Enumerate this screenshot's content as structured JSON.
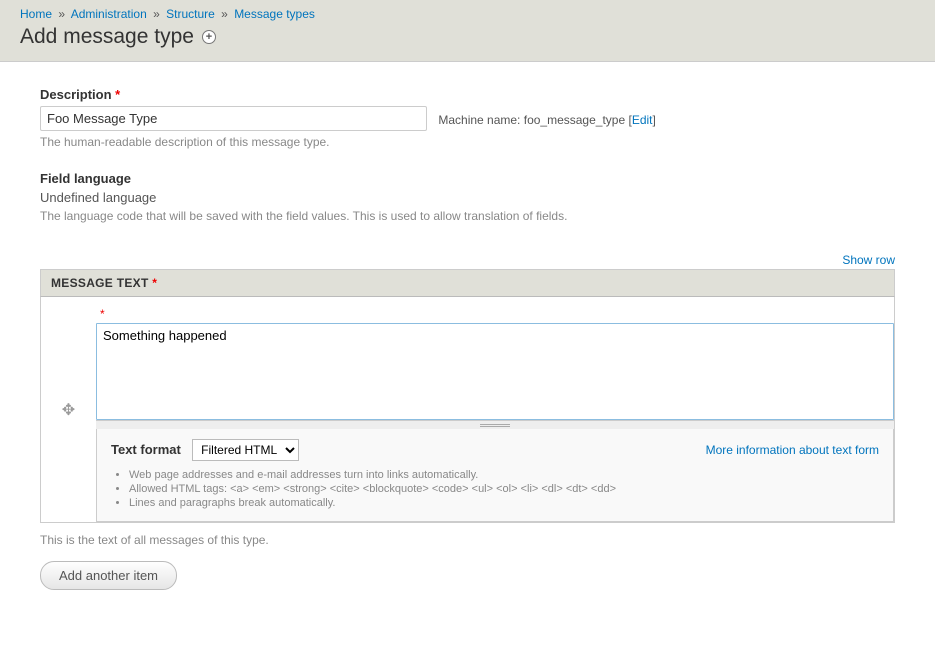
{
  "breadcrumb": {
    "home": "Home",
    "administration": "Administration",
    "structure": "Structure",
    "message_types": "Message types",
    "separator": "»"
  },
  "page_title": "Add message type",
  "description_field": {
    "label": "Description",
    "value": "Foo Message Type",
    "help": "The human-readable description of this message type.",
    "machine_name_label": "Machine name:",
    "machine_name_value": "foo_message_type",
    "edit_label": "Edit"
  },
  "field_language": {
    "label": "Field language",
    "value": "Undefined language",
    "help": "The language code that will be saved with the field values. This is used to allow translation of fields."
  },
  "message_text": {
    "show_row_label": "Show row",
    "section_label": "MESSAGE TEXT",
    "textarea_value": "Something happened",
    "format_label": "Text format",
    "format_selected": "Filtered HTML",
    "more_info_label": "More information about text form",
    "tips": [
      "Web page addresses and e-mail addresses turn into links automatically.",
      "Allowed HTML tags: <a> <em> <strong> <cite> <blockquote> <code> <ul> <ol> <li> <dl> <dt> <dd>",
      "Lines and paragraphs break automatically."
    ],
    "below_help": "This is the text of all messages of this type.",
    "add_another_label": "Add another item"
  }
}
